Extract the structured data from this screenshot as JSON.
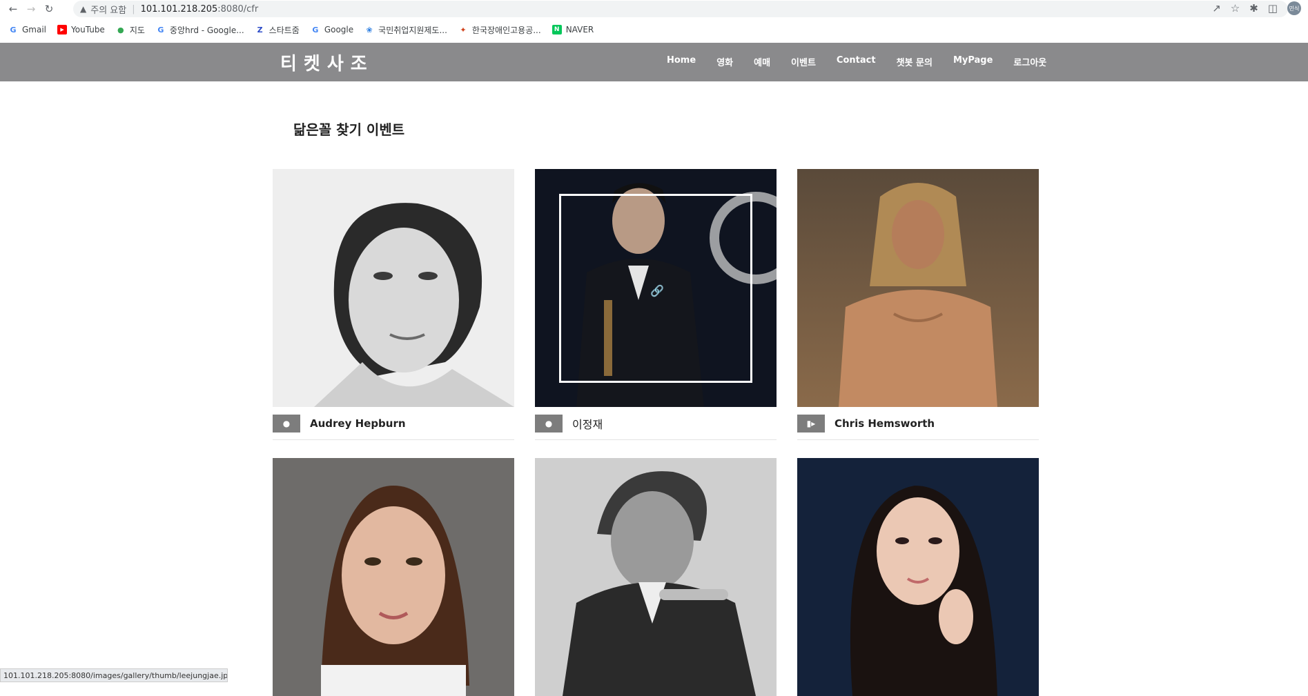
{
  "browser": {
    "warning_text": "주의 요함",
    "url_host": "101.101.218.205",
    "url_path": ":8080/cfr",
    "profile_initials": "민식",
    "bookmarks": [
      {
        "label": "Gmail",
        "icon": "google-icon",
        "color": "#4285f4"
      },
      {
        "label": "YouTube",
        "icon": "youtube-icon",
        "color": "#ff0000"
      },
      {
        "label": "지도",
        "icon": "maps-icon",
        "color": "#34a853"
      },
      {
        "label": "중앙hrd - Google...",
        "icon": "google-icon",
        "color": "#4285f4"
      },
      {
        "label": "스타트줌",
        "icon": "zoom-icon",
        "color": "#2d4cc8"
      },
      {
        "label": "Google",
        "icon": "google-icon",
        "color": "#4285f4"
      },
      {
        "label": "국민취업지원제도...",
        "icon": "gov-icon",
        "color": "#2a7de1"
      },
      {
        "label": "한국장애인고용공...",
        "icon": "agency-icon",
        "color": "#d0421b"
      },
      {
        "label": "NAVER",
        "icon": "naver-icon",
        "color": "#03c75a"
      }
    ],
    "status_url": "101.101.218.205:8080/images/gallery/thumb/leejungjae.jpg"
  },
  "site": {
    "logo": "티켓사조",
    "menu": [
      "Home",
      "영화",
      "예매",
      "이벤트",
      "Contact",
      "챗봇 문의",
      "MyPage",
      "로그아웃"
    ]
  },
  "page": {
    "title": "닮은꼴 찾기 이벤트",
    "cards": [
      {
        "name": "Audrey Hepburn",
        "media_icon": "camera-icon"
      },
      {
        "name": "이정재",
        "media_icon": "camera-icon"
      },
      {
        "name": "Chris Hemsworth",
        "media_icon": "video-icon"
      },
      {
        "name": "",
        "media_icon": ""
      },
      {
        "name": "",
        "media_icon": ""
      },
      {
        "name": "",
        "media_icon": ""
      }
    ]
  }
}
